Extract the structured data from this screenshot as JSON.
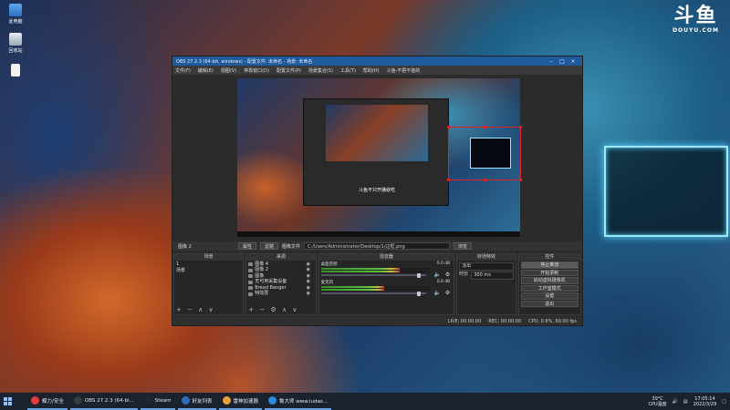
{
  "desktop": {
    "icons": [
      {
        "label": "此电脑",
        "icon": "computer-icon"
      },
      {
        "label": "回收站",
        "icon": "recycle-bin-icon"
      },
      {
        "label": "",
        "icon": "file-icon"
      }
    ],
    "logo_text": "斗鱼",
    "logo_sub": "DOUYU.COM"
  },
  "obs": {
    "title": "OBS 27.2.3 (64-bit, windows) - 配置文件: 未命名 - 场景: 未命名",
    "menu": [
      "文件(F)",
      "编辑(E)",
      "视图(V)",
      "停靠窗口(D)",
      "配置文件(P)",
      "场景集合(S)",
      "工具(T)",
      "帮助(H)",
      "斗鱼-不把不能的"
    ],
    "preview_caption": "斗鱼不只开播就吃",
    "selected_source": "图像 2",
    "properties_label": "属性",
    "filters_label": "滤镜",
    "image_file_label": "图像文件",
    "image_path": "C:/Users/Administrator/Desktop/1/边框.png",
    "browse_label": "浏览",
    "docks": {
      "scenes": {
        "title": "场景",
        "items": [
          "1",
          "场景"
        ]
      },
      "sources": {
        "title": "来源",
        "items": [
          "图像 4",
          "图像 2",
          "图像",
          "无可用采集设备",
          "Bread Banger",
          "特效层"
        ]
      },
      "mixer": {
        "title": "混音器",
        "tracks": [
          {
            "name": "桌面音频",
            "db": "0.0 dB",
            "level": 0.72,
            "volume": 0.92
          },
          {
            "name": "麦克风",
            "db": "0.0 dB",
            "level": 0.58,
            "volume": 0.92
          }
        ]
      },
      "transitions": {
        "title": "转场特效",
        "type": "淡出",
        "duration_label": "时长",
        "duration": "300 ms"
      },
      "controls": {
        "title": "控件",
        "buttons": [
          "停止推流",
          "开始录制",
          "启动虚拟摄像机",
          "工作室模式",
          "设置",
          "退出"
        ]
      }
    },
    "status": {
      "live": "LIVE: 00:00:00",
      "rec": "REC: 00:00:00",
      "cpu": "CPU: 0.6%, 60.00 fps"
    }
  },
  "taskbar": {
    "items": [
      {
        "label": "蝶力/安全",
        "color": "#e23b3b"
      },
      {
        "label": "OBS 27.2.3 (64-bi...",
        "color": "#3a3a3a"
      },
      {
        "label": "Steam",
        "color": "#1b2838"
      },
      {
        "label": "好友列表",
        "color": "#2e6db5"
      },
      {
        "label": "雷神加速器",
        "color": "#e9a23b"
      },
      {
        "label": "鲁大师 www.ludas...",
        "color": "#2f8ad8"
      }
    ],
    "weather": "39°C",
    "weather_sub": "CPU温度",
    "time": "17:05:14",
    "date": "2022/3/29"
  },
  "colors": {
    "selection": "#e02020",
    "frame_glow": "#9fe6ff",
    "title_bar": "#1e5a9c"
  }
}
